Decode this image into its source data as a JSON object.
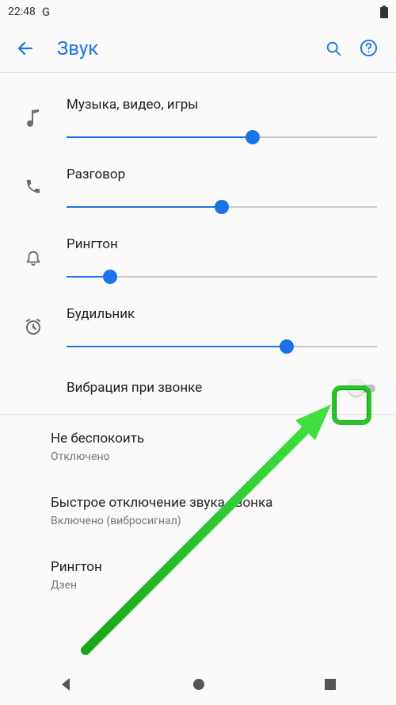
{
  "statusbar": {
    "time": "22:48"
  },
  "appbar": {
    "title": "Звук"
  },
  "sliders": [
    {
      "label": "Музыка, видео, игры",
      "value": 60
    },
    {
      "label": "Разговор",
      "value": 50
    },
    {
      "label": "Рингтон",
      "value": 14
    },
    {
      "label": "Будильник",
      "value": 71
    }
  ],
  "vibrate": {
    "label": "Вибрация при звонке",
    "on": false
  },
  "items": [
    {
      "title": "Не беспокоить",
      "subtitle": "Отключено"
    },
    {
      "title": "Быстрое отключение звука звонка",
      "subtitle": "Включено (вибросигнал)"
    },
    {
      "title": "Рингтон",
      "subtitle": "Дзен"
    }
  ],
  "colors": {
    "accent": "#1a73e8",
    "highlight": "#26c426"
  }
}
